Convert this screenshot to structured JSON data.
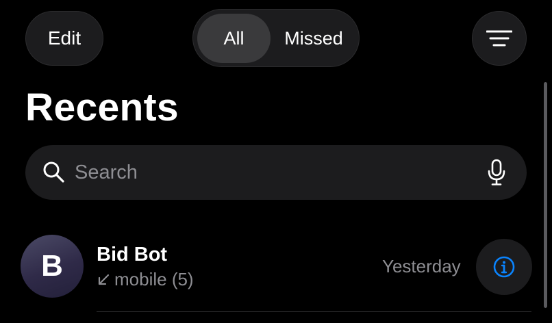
{
  "header": {
    "edit_label": "Edit",
    "segments": {
      "all": "All",
      "missed": "Missed"
    },
    "selected_segment": "All",
    "filter_icon": "filter-lines-icon"
  },
  "title": "Recents",
  "search": {
    "placeholder": "Search",
    "value": "",
    "icon": "search-icon",
    "mic_icon": "microphone-icon"
  },
  "recents": [
    {
      "initial": "B",
      "name": "Bid Bot",
      "call_type_icon": "incoming-arrow-icon",
      "detail": "mobile (5)",
      "time": "Yesterday",
      "info_icon": "info-icon"
    }
  ],
  "colors": {
    "background": "#000000",
    "surface": "#1c1c1e",
    "selected_segment": "#3a3a3c",
    "secondary_text": "#8e8e93",
    "accent": "#0a84ff"
  }
}
